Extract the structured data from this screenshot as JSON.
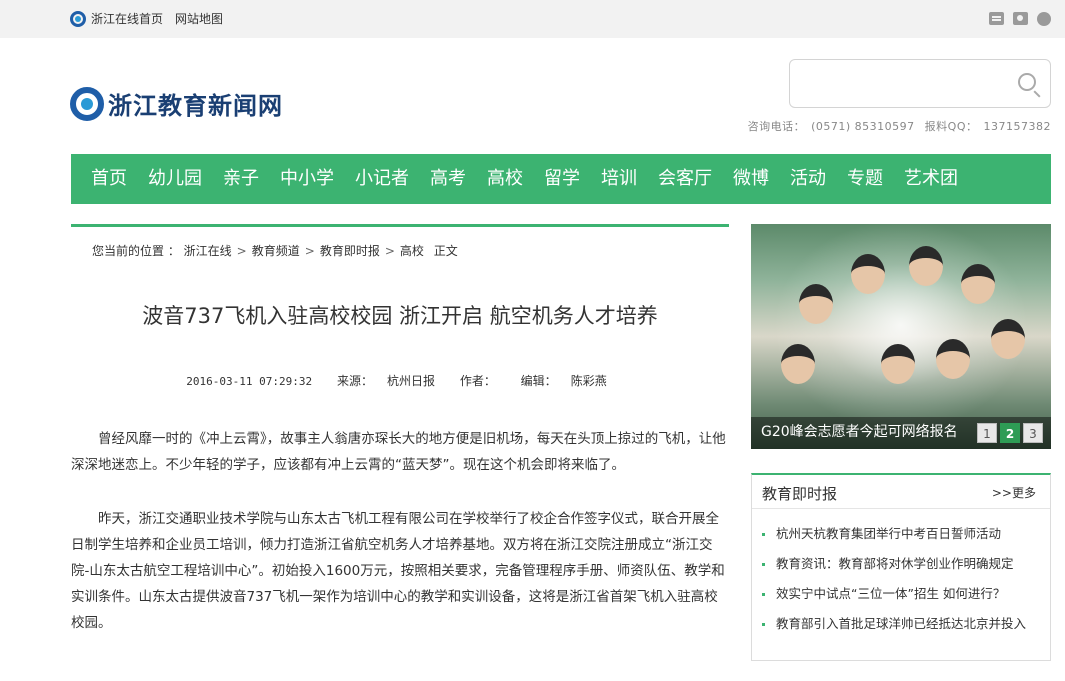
{
  "topbar": {
    "home_label": "浙江在线首页",
    "sitemap_label": "网站地图",
    "icons": [
      "mail-icon",
      "camera-icon",
      "globe-icon"
    ]
  },
  "header": {
    "brand_name": "浙江教育新闻网",
    "search_placeholder": "",
    "contact": {
      "phone_label": "咨询电话：",
      "phone_value": "(0571) 85310597",
      "qq_label": "报料QQ：",
      "qq_value": "137157382"
    }
  },
  "nav": {
    "items": [
      "首页",
      "幼儿园",
      "亲子",
      "中小学",
      "小记者",
      "高考",
      "高校",
      "留学",
      "培训",
      "会客厅",
      "微博",
      "活动",
      "专题",
      "艺术团"
    ]
  },
  "breadcrumb": {
    "prefix": "您当前的位置 ：",
    "items": [
      "浙江在线",
      "教育频道",
      "教育即时报",
      "高校"
    ],
    "suffix": "正文"
  },
  "article": {
    "title": "波音737飞机入驻高校校园 浙江开启 航空机务人才培养",
    "date": "2016-03-11 07:29:32",
    "source_label": "来源：",
    "source_value": "杭州日报",
    "author_label": "作者：",
    "editor_label": "编辑：",
    "editor_value": "陈彩燕",
    "paragraphs": [
      "曾经风靡一时的《冲上云霄》，故事主人翁唐亦琛长大的地方便是旧机场，每天在头顶上掠过的飞机，让他深深地迷恋上。不少年轻的学子，应该都有冲上云霄的“蓝天梦”。现在这个机会即将来临了。",
      "昨天，浙江交通职业技术学院与山东太古飞机工程有限公司在学校举行了校企合作签字仪式，联合开展全日制学生培养和企业员工培训，倾力打造浙江省航空机务人才培养基地。双方将在浙江交院注册成立“浙江交院-山东太古航空工程培训中心”。初始投入1600万元，按照相关要求，完备管理程序手册、师资队伍、教学和实训条件。山东太古提供波音737飞机一架作为培训中心的教学和实训设备，这将是浙江省首架飞机入驻高校校园。"
    ]
  },
  "slider": {
    "caption": "G20峰会志愿者今起可网络报名",
    "pages": [
      "1",
      "2",
      "3"
    ],
    "active_page": "2"
  },
  "newsbox": {
    "title": "教育即时报",
    "more_label": ">>更多",
    "items": [
      "杭州天杭教育集团举行中考百日誓师活动",
      "教育资讯：教育部将对休学创业作明确规定",
      "效实宁中试点“三位一体”招生 如何进行？",
      "教育部引入首批足球洋帅已经抵达北京并投入"
    ]
  },
  "colors": {
    "nav_green": "#3cb371",
    "brand_blue": "#1a3f73",
    "active_dot": "#2e9c55"
  }
}
